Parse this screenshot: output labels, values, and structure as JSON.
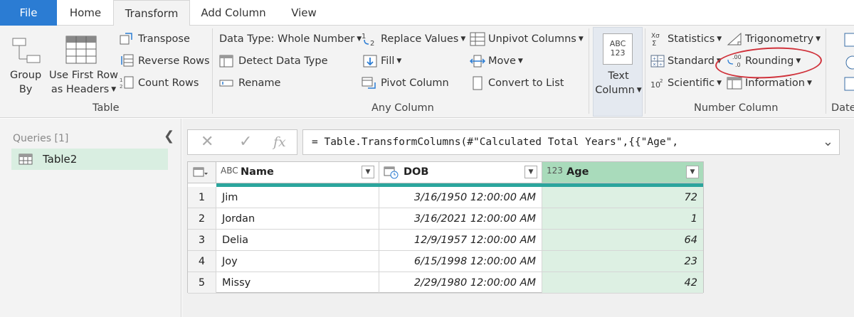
{
  "tabs": {
    "file": "File",
    "home": "Home",
    "transform": "Transform",
    "add_column": "Add Column",
    "view": "View"
  },
  "ribbon": {
    "table_group": {
      "group_by": [
        "Group",
        "By"
      ],
      "use_first_row": [
        "Use First Row",
        "as Headers"
      ],
      "transpose": "Transpose",
      "reverse_rows": "Reverse Rows",
      "count_rows": "Count Rows",
      "label": "Table"
    },
    "any_column_group": {
      "data_type": "Data Type: Whole Number",
      "detect_data_type": "Detect Data Type",
      "rename": "Rename",
      "replace_values": "Replace Values",
      "fill": "Fill",
      "pivot_column": "Pivot Column",
      "unpivot_columns": "Unpivot Columns",
      "move": "Move",
      "convert_to_list": "Convert to List",
      "label": "Any Column"
    },
    "text_column": {
      "icon_text": [
        "ABC",
        "123"
      ],
      "label": [
        "Text",
        "Column"
      ]
    },
    "number_column_group": {
      "statistics": "Statistics",
      "standard": "Standard",
      "scientific": "Scientific",
      "trigonometry": "Trigonometry",
      "rounding": "Rounding",
      "information": "Information",
      "label": "Number Column"
    },
    "date_group_label": "Date"
  },
  "queries": {
    "header": "Queries [1]",
    "items": [
      "Table2"
    ]
  },
  "formula": {
    "text": "= Table.TransformColumns(#\"Calculated Total Years\",{{\"Age\","
  },
  "grid": {
    "columns": [
      {
        "type_icon": "ABC",
        "name": "Name"
      },
      {
        "type_icon": "date",
        "name": "DOB"
      },
      {
        "type_icon": "123",
        "name": "Age"
      }
    ],
    "rows": [
      {
        "idx": "1",
        "name": "Jim",
        "dob": "3/16/1950 12:00:00 AM",
        "age": "72"
      },
      {
        "idx": "2",
        "name": "Jordan",
        "dob": "3/16/2021 12:00:00 AM",
        "age": "1"
      },
      {
        "idx": "3",
        "name": "Delia",
        "dob": "12/9/1957 12:00:00 AM",
        "age": "64"
      },
      {
        "idx": "4",
        "name": "Joy",
        "dob": "6/15/1998 12:00:00 AM",
        "age": "23"
      },
      {
        "idx": "5",
        "name": "Missy",
        "dob": "2/29/1980 12:00:00 AM",
        "age": "42"
      }
    ]
  },
  "colors": {
    "file_tab": "#2b7cd3",
    "selected_query": "#d9eee1",
    "age_column": "#ddf0e3",
    "teal_bar": "#2ba59d",
    "annotation_circle": "#d0323b"
  }
}
